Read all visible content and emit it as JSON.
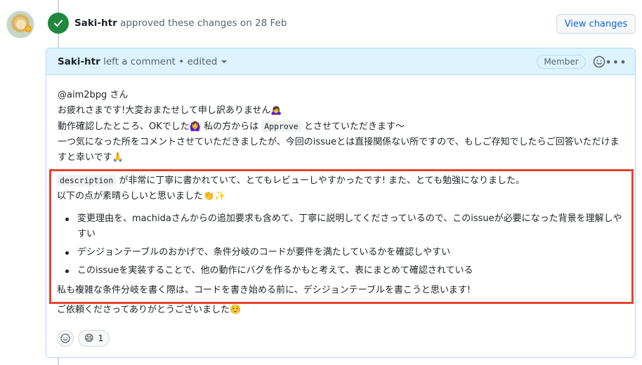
{
  "event": {
    "user": "Saki-htr",
    "action_text": "approved these changes on 28 Feb",
    "view_changes_label": "View changes"
  },
  "comment": {
    "user": "Saki-htr",
    "meta": "left a comment • edited",
    "badge": "Member",
    "greeting": "@aim2bpg さん",
    "line1": "お疲れさまです!大変おまたせして申し訳ありません🙇‍♀️",
    "line2_before": "動作確認したところ、OKでした🙆‍♀️ 私の方からは",
    "line2_code": "Approve",
    "line2_after": "とさせていただきます〜",
    "line3": "一つ気になった所をコメントさせていただきましたが、今回のissueとは直接関係ない所ですので、もしご存知でしたらご回答いただけますと幸いです🙏",
    "hl_code": "description",
    "hl_line1_after": "が非常に丁寧に書かれていて、とてもレビューしやすかったです! また、とても勉強になりました。",
    "hl_line2": "以下の点が素晴らしいと思いました👏✨",
    "bullets": [
      "変更理由を、machidaさんからの追加要求も含めて、丁寧に説明してくださっているので、このissueが必要になった背景を理解しやすい",
      "デシジョンテーブルのおかげで、条件分岐のコードが要件を満たしているかを確認しやすい",
      "このissueを実装することで、他の動作にバグを作るかもと考えて、表にまとめて確認されている"
    ],
    "closing": "私も複雑な条件分岐を書く際は、コードを書き始める前に、デシジョンテーブルを書こうと思います!",
    "final": "ご依頼くださってありがとうございました☺️"
  },
  "reactions": {
    "add_icon": "smiley-add-icon",
    "items": [
      {
        "emoji": "😄",
        "count": "1"
      }
    ]
  },
  "colors": {
    "approve_green": "#1f883d",
    "highlight_red": "#e8432d",
    "header_blue": "#ddf4ff",
    "link_blue": "#0969da"
  }
}
